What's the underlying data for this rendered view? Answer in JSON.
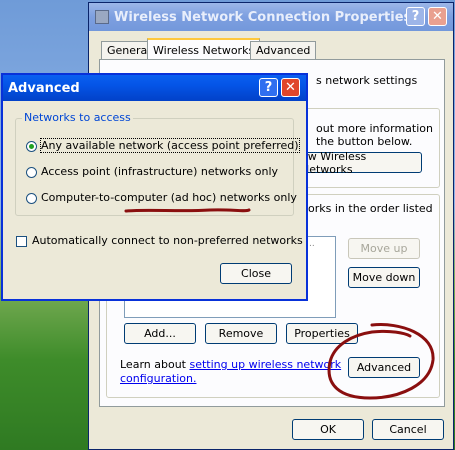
{
  "properties_window": {
    "title": "Wireless Network Connection Properties",
    "tabs": [
      {
        "label": "General"
      },
      {
        "label": "Wireless Networks"
      },
      {
        "label": "Advanced"
      }
    ],
    "partial_texts": {
      "line1": "s network settings",
      "line2": "out more information",
      "line3": "the button below.",
      "line4": "orks in the order listed"
    },
    "view_networks_label": "ew Wireless Networks",
    "move_up_label": "Move up",
    "move_down_label": "Move down",
    "add_label": "Add...",
    "remove_label": "Remove",
    "properties_label": "Properties",
    "learn_prefix": "Learn about ",
    "learn_link1": "setting up wireless network",
    "learn_link2": "configuration.",
    "advanced_label": "Advanced",
    "ok_label": "OK",
    "cancel_label": "Cancel"
  },
  "advanced_dialog": {
    "title": "Advanced",
    "group_label": "Networks to access",
    "options": [
      {
        "label": "Any available network (access point preferred)",
        "selected": true
      },
      {
        "label": "Access point (infrastructure) networks only",
        "selected": false
      },
      {
        "label": "Computer-to-computer (ad hoc) networks only",
        "selected": false
      }
    ],
    "auto_connect_label": "Automatically connect to non-preferred networks",
    "auto_connect_checked": false,
    "close_label": "Close"
  },
  "colors": {
    "annotation": "#8a0f0f",
    "titlebar": "#0454e6"
  }
}
